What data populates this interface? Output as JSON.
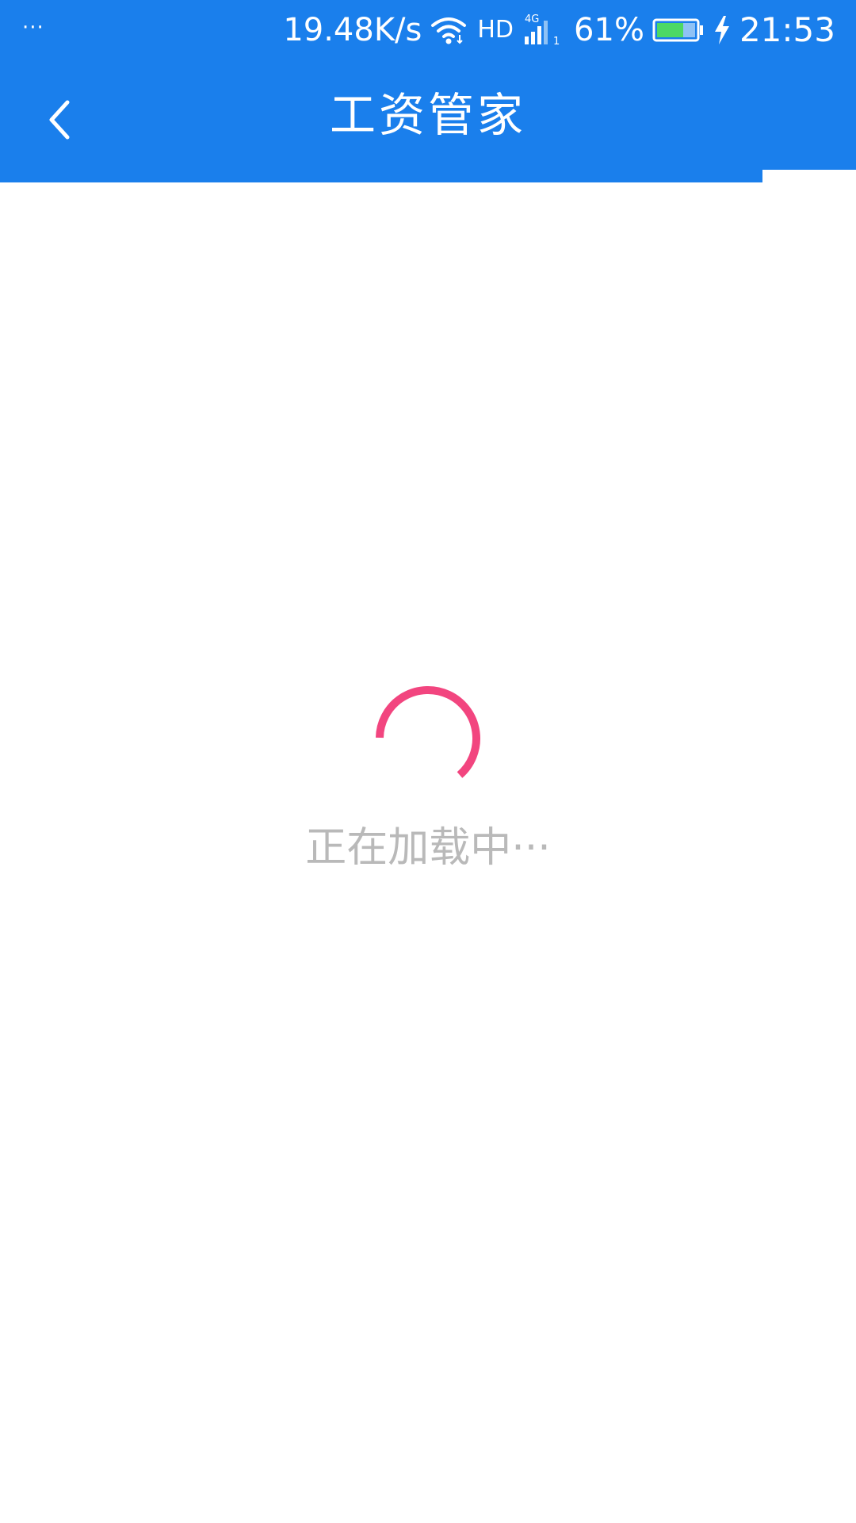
{
  "status_bar": {
    "dots": "···",
    "net_speed": "19.48K/s",
    "hd": "HD",
    "network_type": "4G",
    "sim_slot": "1",
    "battery_percent": "61%",
    "time": "21:53",
    "icons": [
      "wifi-icon",
      "cellular-signal-icon",
      "battery-icon",
      "charging-bolt-icon"
    ]
  },
  "app_bar": {
    "title": "工资管家",
    "back_icon": "chevron-left-icon"
  },
  "loading": {
    "text": "正在加载中···",
    "spinner_icon": "loading-spinner-icon"
  },
  "colors": {
    "primary": "#1A7FEC",
    "spinner": "#F2457F",
    "loading_text": "#B9B9B9",
    "battery_fill": "#4CD964",
    "background": "#FFFFFF"
  }
}
